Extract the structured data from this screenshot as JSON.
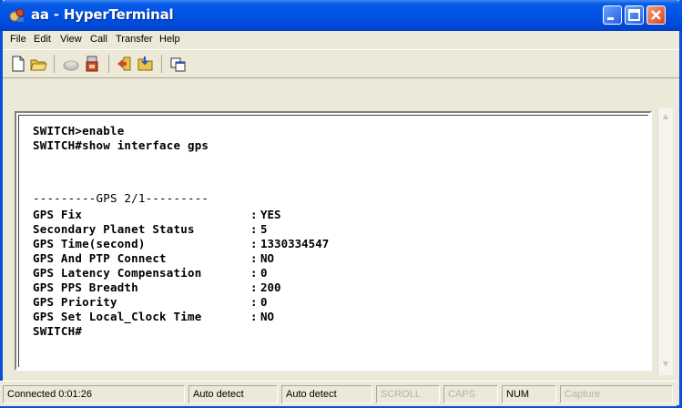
{
  "window": {
    "title": "aa - HyperTerminal",
    "accent_color": "#0055e5"
  },
  "menu": {
    "items": [
      "File",
      "Edit",
      "View",
      "Call",
      "Transfer",
      "Help"
    ]
  },
  "toolbar": {
    "icons": [
      "new-icon",
      "open-icon",
      "disconnect-icon",
      "dial-icon",
      "send-icon",
      "receive-icon",
      "properties-icon"
    ]
  },
  "terminal": {
    "lines": [
      "SWITCH>enable",
      "SWITCH#show interface gps"
    ],
    "header": "---------GPS 2/1---------",
    "rows": [
      {
        "label": "GPS Fix",
        "value": "YES"
      },
      {
        "label": "Secondary Planet Status",
        "value": "5"
      },
      {
        "label": "GPS Time(second)",
        "value": "1330334547"
      },
      {
        "label": "GPS And PTP Connect",
        "value": "NO"
      },
      {
        "label": "GPS Latency Compensation",
        "value": "0"
      },
      {
        "label": "GPS PPS Breadth",
        "value": "200"
      },
      {
        "label": "GPS Priority",
        "value": "0"
      },
      {
        "label": "GPS Set Local_Clock Time",
        "value": "NO"
      }
    ],
    "prompt": "SWITCH#"
  },
  "status": {
    "connected": "Connected 0:01:26",
    "detect1": "Auto detect",
    "detect2": "Auto detect",
    "scroll": "SCROLL",
    "caps": "CAPS",
    "num": "NUM",
    "capture": "Capture"
  }
}
